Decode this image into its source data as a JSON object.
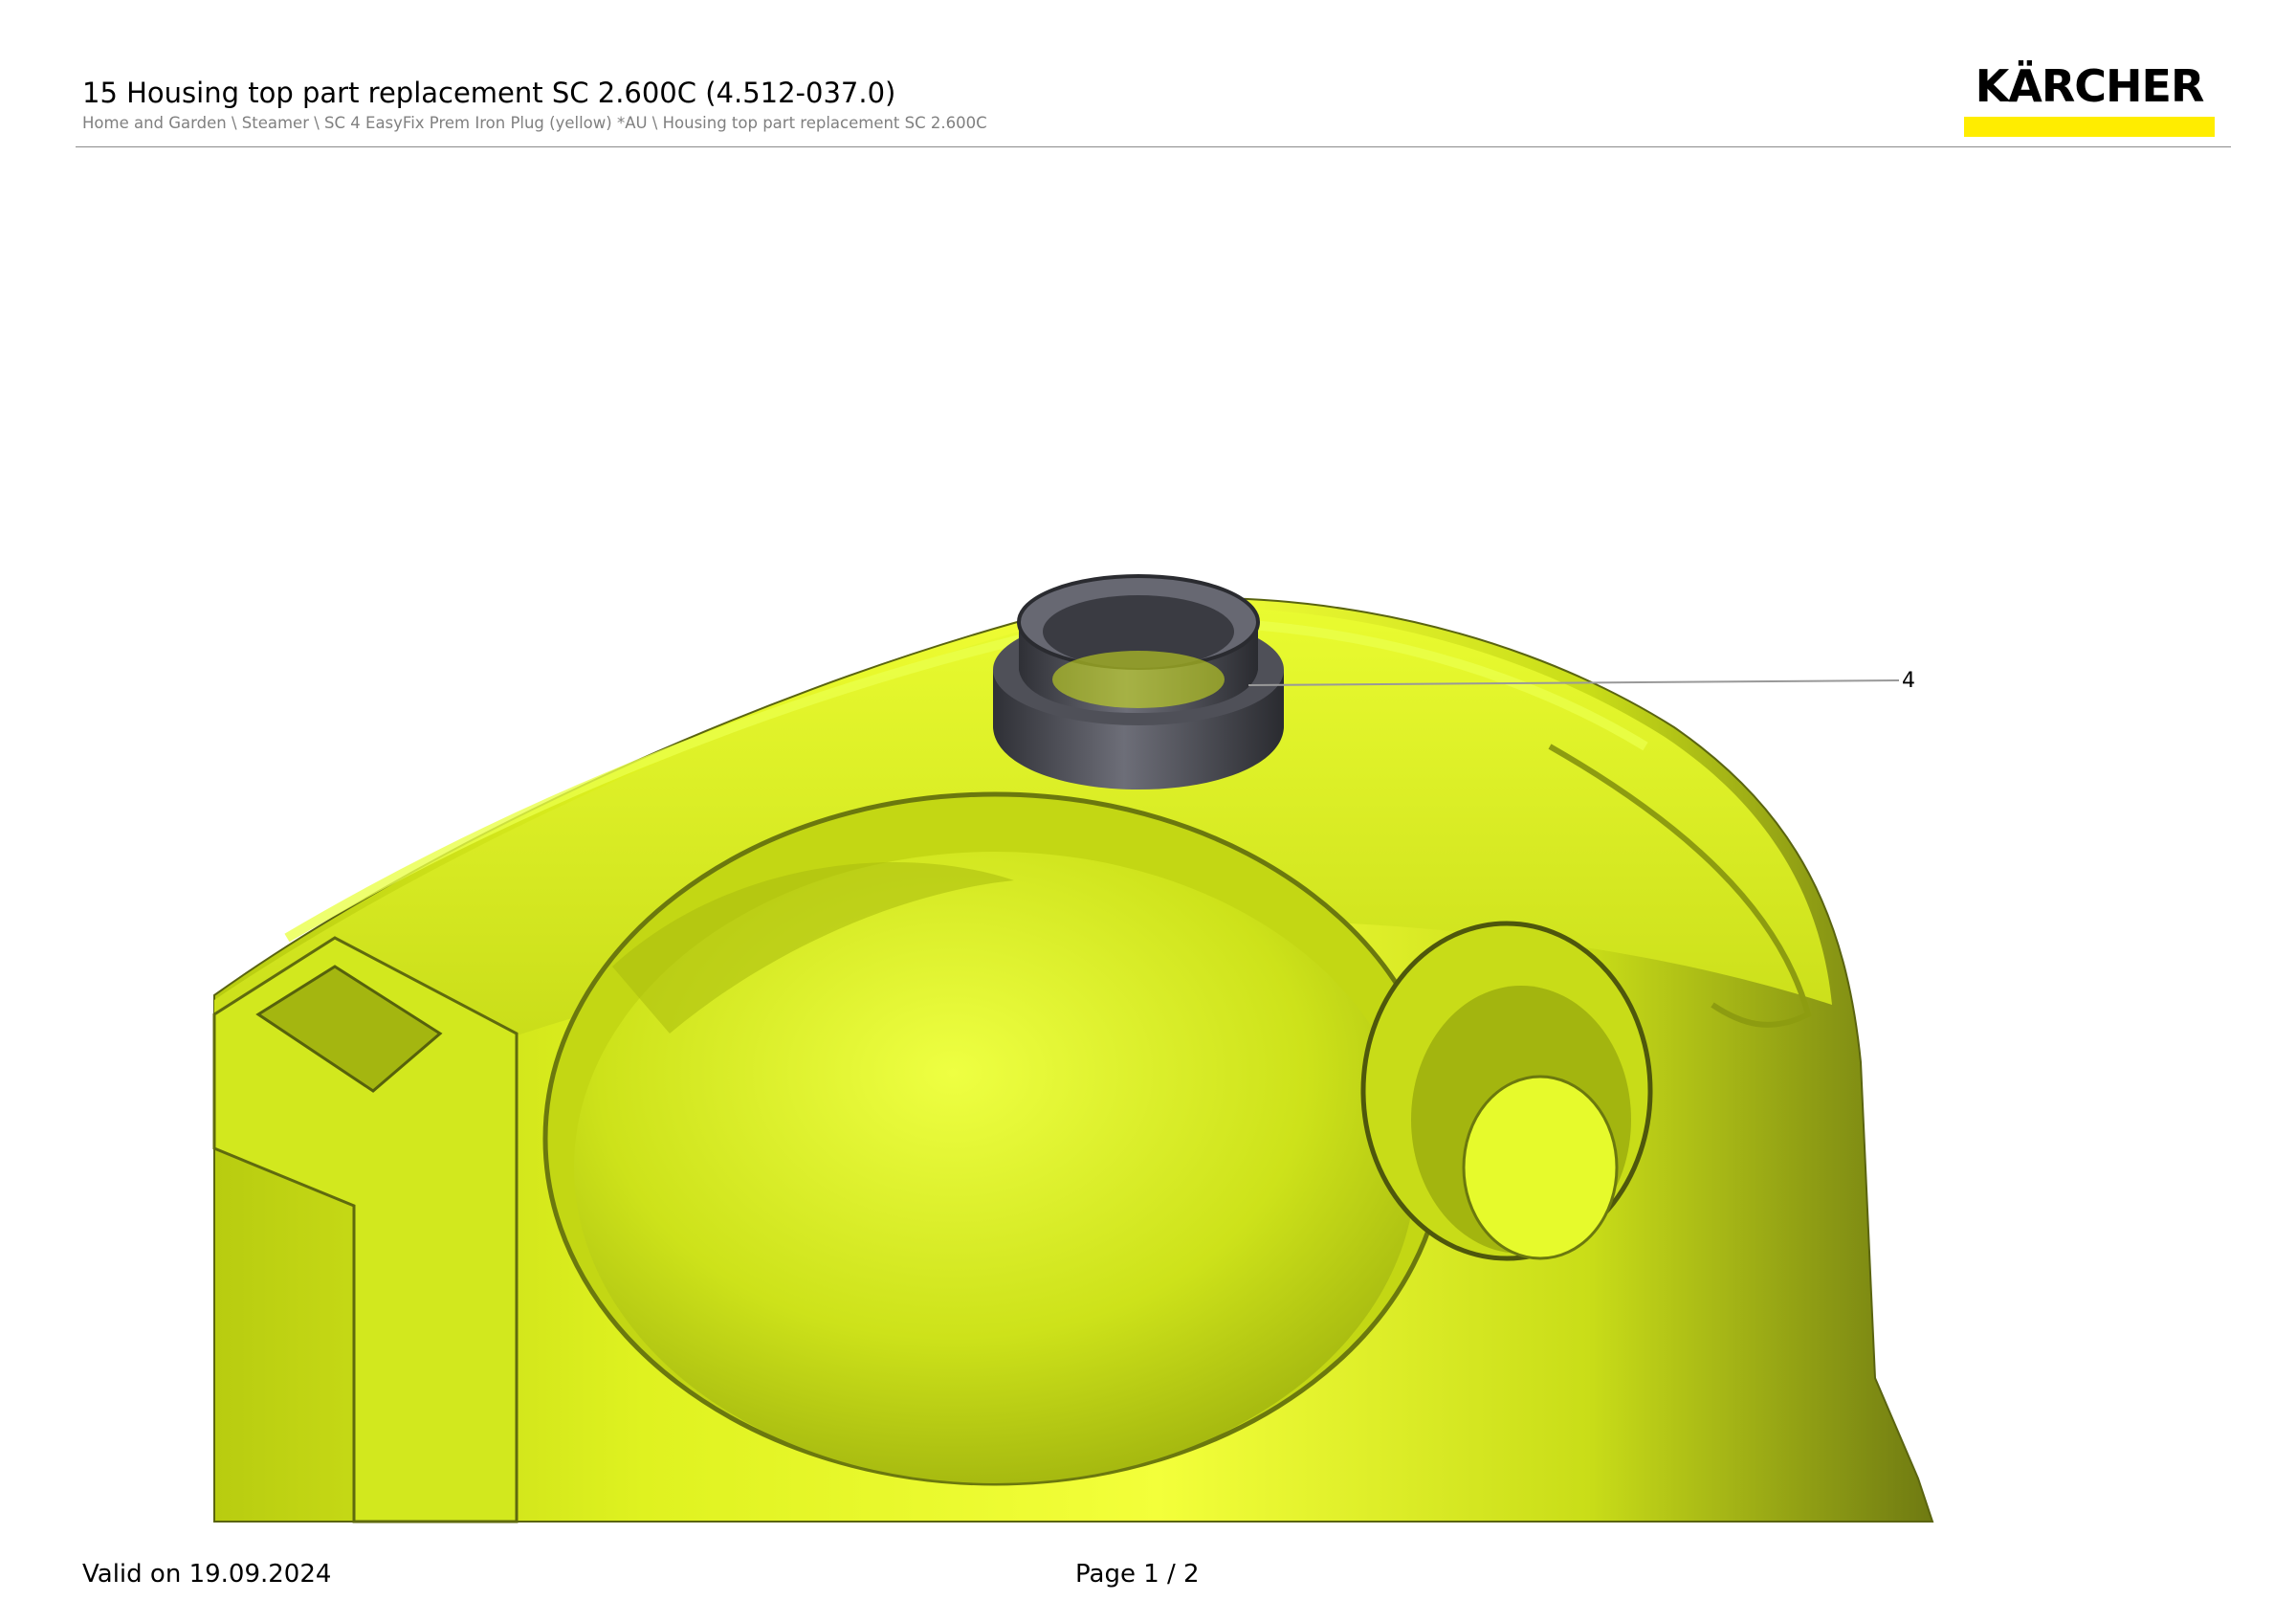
{
  "header": {
    "title": "15 Housing top part replacement SC 2.600C (4.512-037.0)",
    "breadcrumb": "Home and Garden \\ Steamer \\ SC 4 EasyFix Prem Iron Plug (yellow) *AU \\ Housing top part replacement SC 2.600C"
  },
  "logo": {
    "text": "KÄRCHER",
    "bar_color": "#ffed00"
  },
  "drawing": {
    "subject": "housing top part",
    "part_color": "#d7f020",
    "seal_color": "#55565e",
    "callouts": [
      {
        "label": "4"
      }
    ]
  },
  "footer": {
    "valid": "Valid on 19.09.2024",
    "page": "Page 1 / 2"
  }
}
